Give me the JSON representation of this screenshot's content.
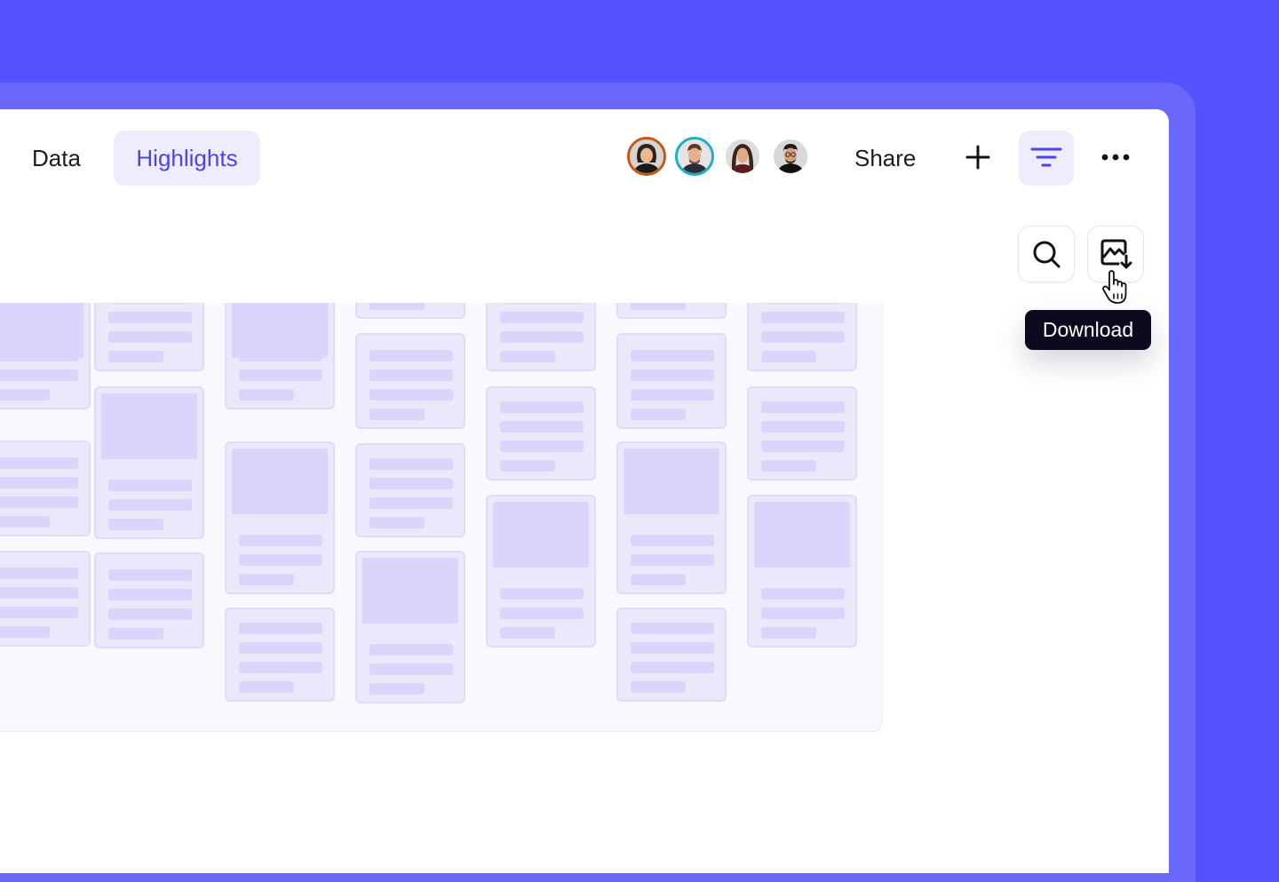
{
  "tabs": [
    {
      "label": "Data",
      "active": false
    },
    {
      "label": "Highlights",
      "active": true
    }
  ],
  "collaborators": [
    {
      "name": "collaborator-1",
      "ring": "#c35a19"
    },
    {
      "name": "collaborator-2",
      "ring": "#1db0c4"
    },
    {
      "name": "collaborator-3",
      "ring": "#ffffff"
    },
    {
      "name": "collaborator-4",
      "ring": "#ffffff"
    }
  ],
  "header": {
    "share_label": "Share",
    "add_icon": "plus-icon",
    "filter_icon": "filter-icon",
    "more_icon": "more-horizontal-icon"
  },
  "toolbar": {
    "search_icon": "search-icon",
    "download_icon": "image-download-icon",
    "tooltip": "Download"
  },
  "colors": {
    "background": "#5552ff",
    "accent": "#4b45e4",
    "accent_soft": "#eeedfd",
    "card": "#ebe8fb",
    "tooltip_bg": "#0d0a20"
  }
}
